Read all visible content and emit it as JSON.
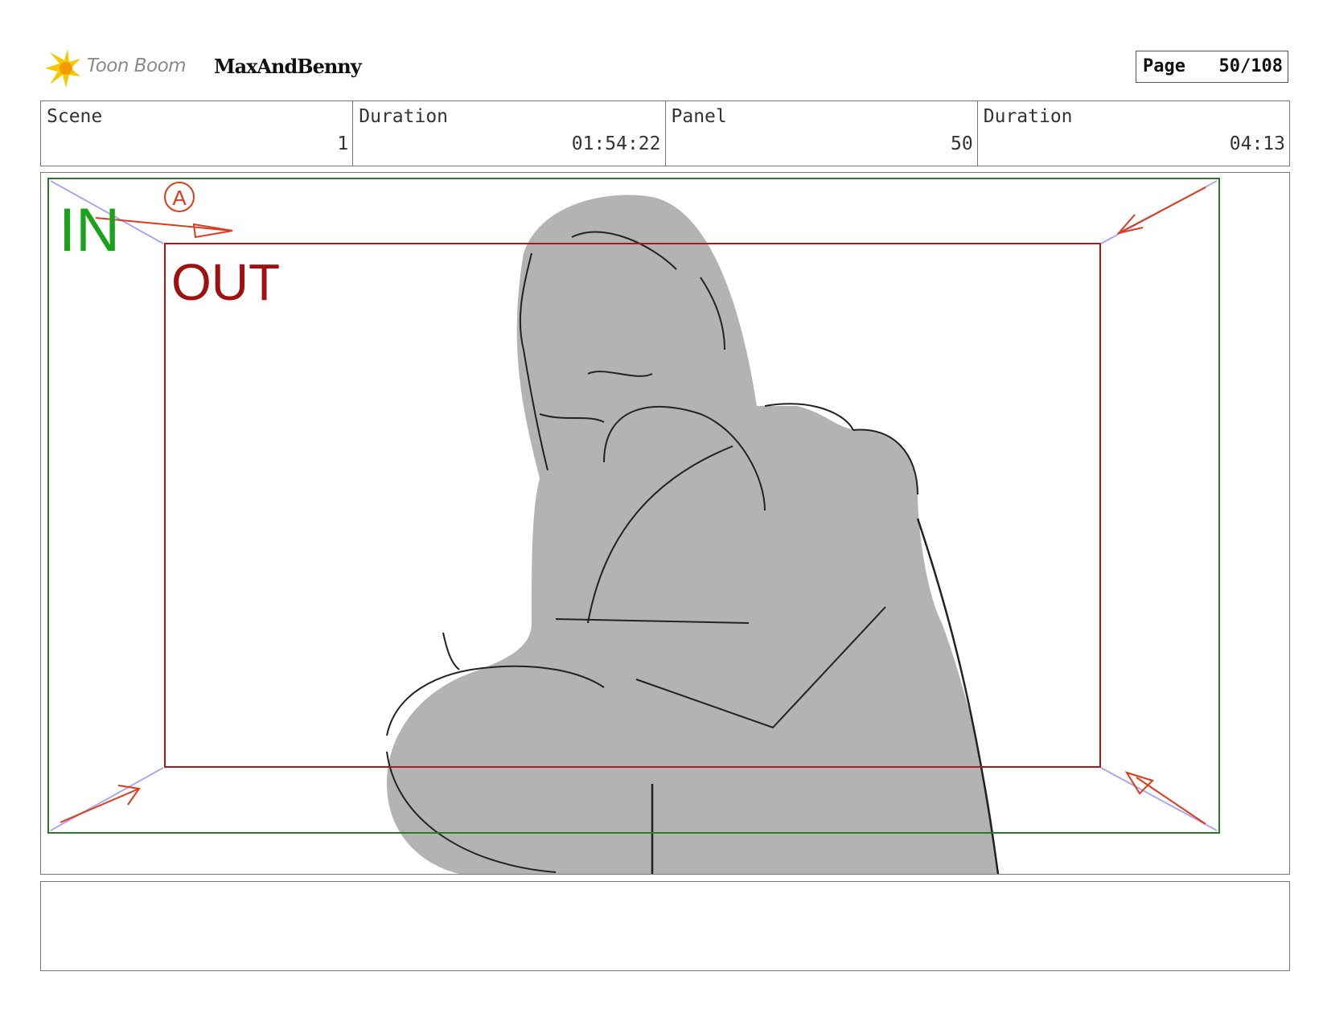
{
  "header": {
    "logo_text": "Toon Boom",
    "project_name": "MaxAndBenny",
    "page_label": "Page",
    "page_value": "50/108"
  },
  "info": {
    "scene_label": "Scene",
    "scene_value": "1",
    "scene_duration_label": "Duration",
    "scene_duration_value": "01:54:22",
    "panel_label": "Panel",
    "panel_value": "50",
    "panel_duration_label": "Duration",
    "panel_duration_value": "04:13"
  },
  "panel": {
    "in_label": "IN",
    "out_label": "OUT",
    "annotation_letter": "A",
    "in_color": "#1aa31a",
    "out_color": "#a01010"
  },
  "notes": {
    "text": ""
  }
}
